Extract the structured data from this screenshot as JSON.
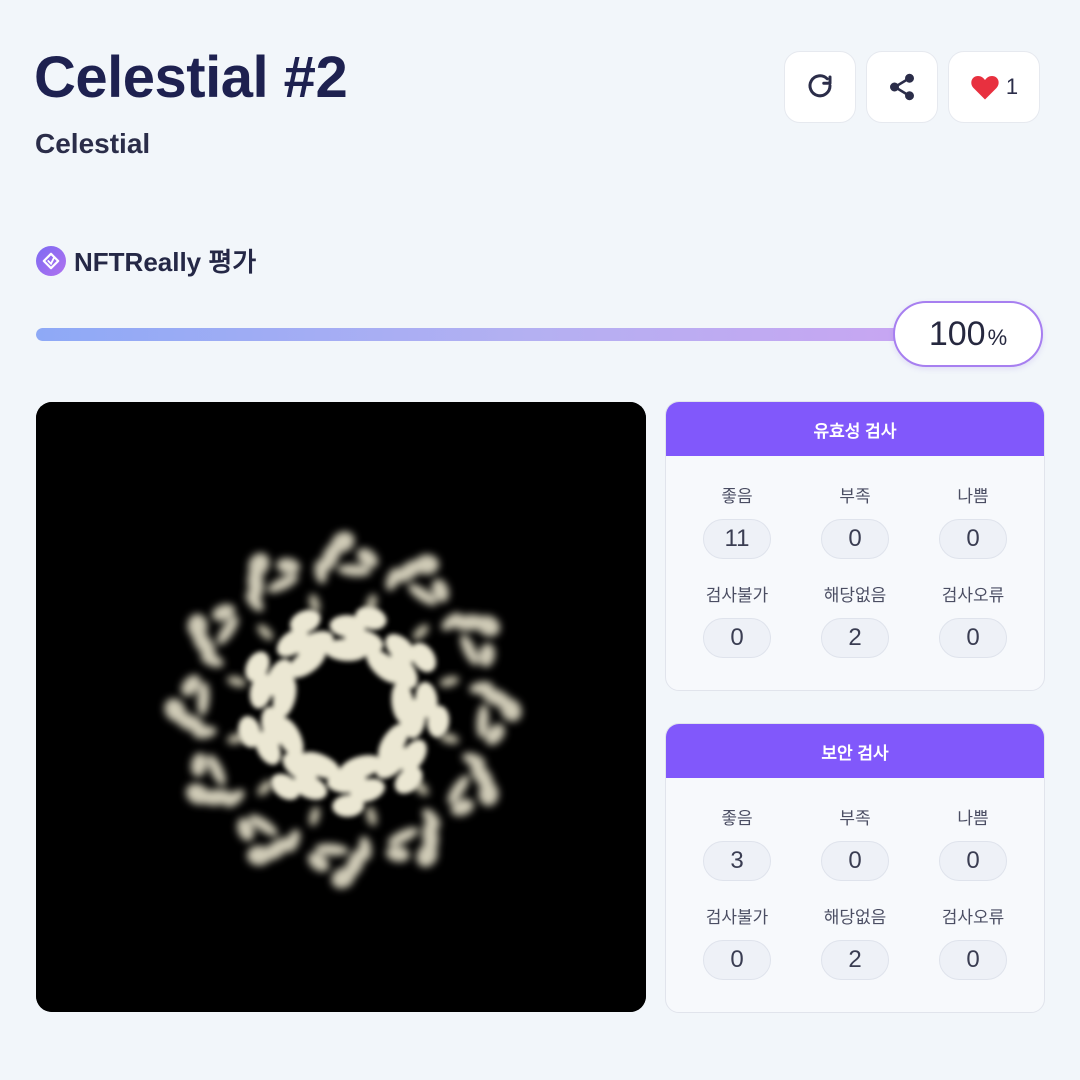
{
  "header": {
    "title": "Celestial #2",
    "collection": "Celestial"
  },
  "actions": {
    "refresh_icon": "refresh-icon",
    "share_icon": "share-icon",
    "like_icon": "heart-icon",
    "like_count": "1",
    "like_color": "#e8303f"
  },
  "rating": {
    "label": "NFTReally 평가",
    "percent_value": "100",
    "percent_unit": "%",
    "fill_fraction": 1.0,
    "accent": "#8158fb"
  },
  "validity": {
    "title": "유효성 검사",
    "cells": [
      {
        "label": "좋음",
        "value": "11"
      },
      {
        "label": "부족",
        "value": "0"
      },
      {
        "label": "나쁨",
        "value": "0"
      },
      {
        "label": "검사불가",
        "value": "0"
      },
      {
        "label": "해당없음",
        "value": "2"
      },
      {
        "label": "검사오류",
        "value": "0"
      }
    ]
  },
  "security": {
    "title": "보안 검사",
    "cells": [
      {
        "label": "좋음",
        "value": "3"
      },
      {
        "label": "부족",
        "value": "0"
      },
      {
        "label": "나쁨",
        "value": "0"
      },
      {
        "label": "검사불가",
        "value": "0"
      },
      {
        "label": "해당없음",
        "value": "2"
      },
      {
        "label": "검사오류",
        "value": "0"
      }
    ]
  }
}
